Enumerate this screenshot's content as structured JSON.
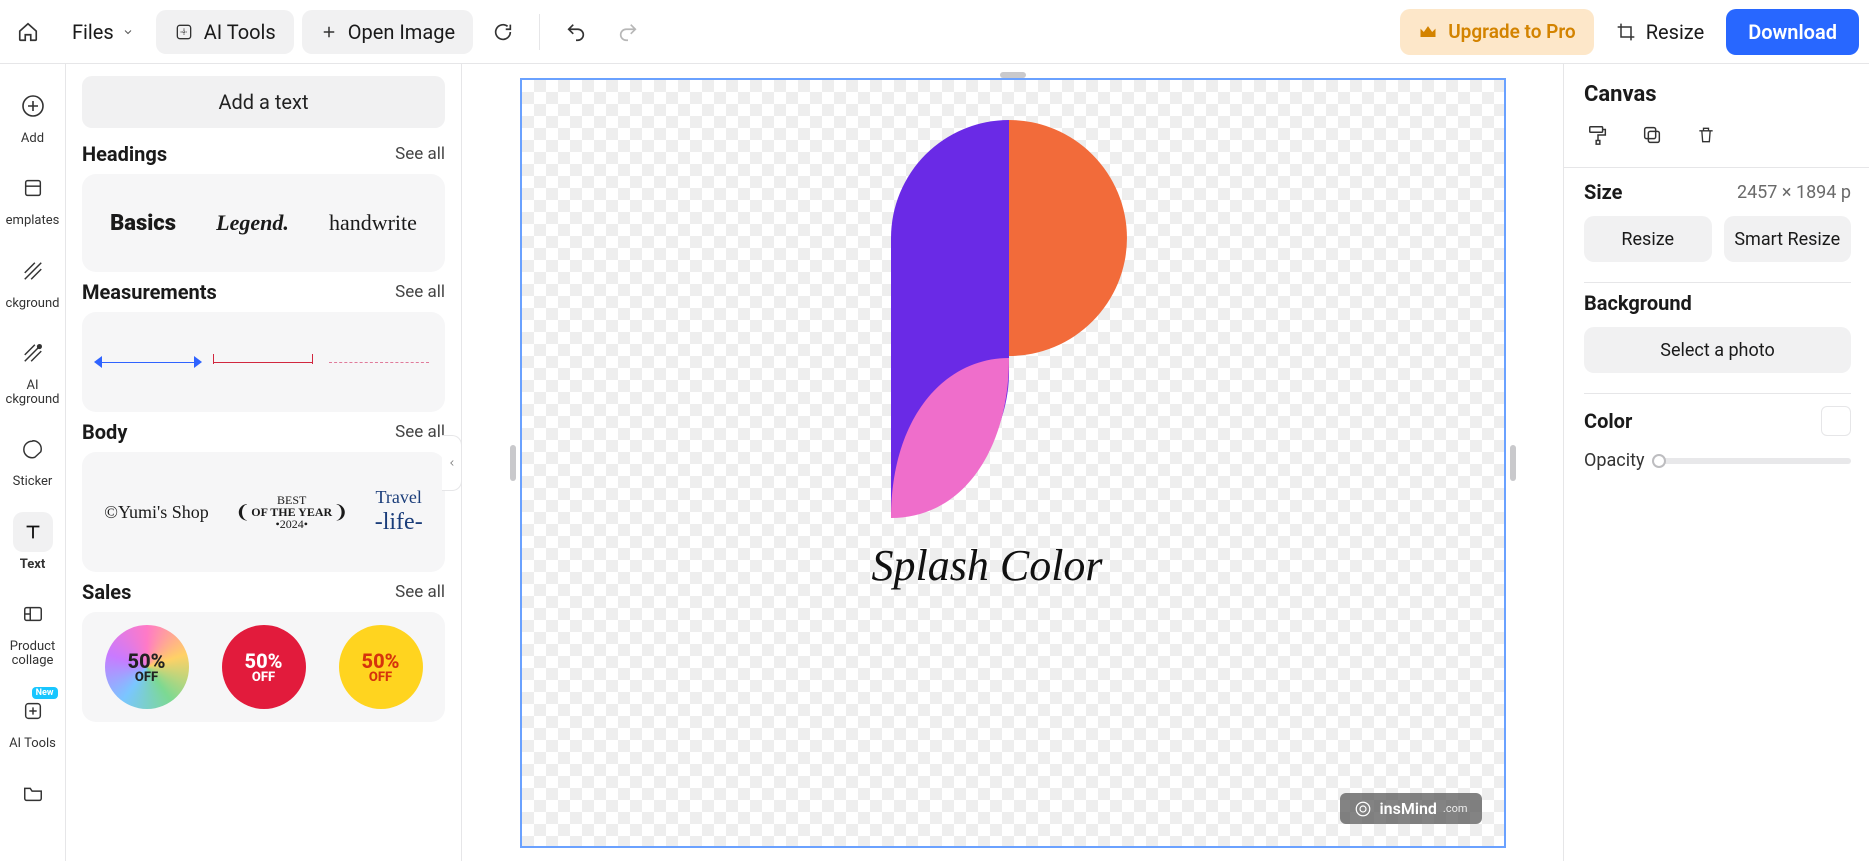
{
  "topbar": {
    "files": "Files",
    "ai_tools": "AI Tools",
    "open_image": "Open Image",
    "upgrade": "Upgrade to Pro",
    "resize": "Resize",
    "download": "Download"
  },
  "rail": {
    "add": "Add",
    "templates": "Templates",
    "background": "Background",
    "ai_background": "AI\nBackground",
    "ai_background_line1": "AI",
    "ai_background_line2": "ckground",
    "sticker": "Sticker",
    "text": "Text",
    "product_collage_line1": "Product",
    "product_collage_line2": "collage",
    "ai_tools": "AI Tools",
    "new_badge": "New"
  },
  "panel": {
    "add_text": "Add a text",
    "headings": {
      "title": "Headings",
      "see_all": "See all",
      "sample1": "Basics",
      "sample2": "Legend.",
      "sample3": "handwrite"
    },
    "measurements": {
      "title": "Measurements",
      "see_all": "See all"
    },
    "body": {
      "title": "Body",
      "see_all": "See all",
      "sample1": "©Yumi's Shop",
      "sample2_line1": "BEST",
      "sample2_line2": "OF THE YEAR",
      "sample2_line3": "•2024•",
      "sample3_line1": "Travel",
      "sample3_line2": "-life-"
    },
    "sales": {
      "title": "Sales",
      "see_all": "See all",
      "b1_big": "50%",
      "b1_small": "OFF",
      "b2_big": "50%",
      "b2_small": "OFF",
      "b3_big": "50%",
      "b3_small": "OFF"
    }
  },
  "canvas": {
    "logo_text": "Splash Color",
    "watermark_brand": "insMind",
    "watermark_domain": ".com"
  },
  "rpanel": {
    "title": "Canvas",
    "size_label": "Size",
    "size_value": "2457 × 1894 p",
    "resize": "Resize",
    "smart_resize": "Smart Resize",
    "background_label": "Background",
    "select_photo": "Select a photo",
    "color_label": "Color",
    "opacity_label": "Opacity"
  },
  "colors": {
    "logo_purple": "#6a2ae6",
    "logo_orange": "#f26b3a",
    "logo_pink": "#ef6ecb"
  }
}
